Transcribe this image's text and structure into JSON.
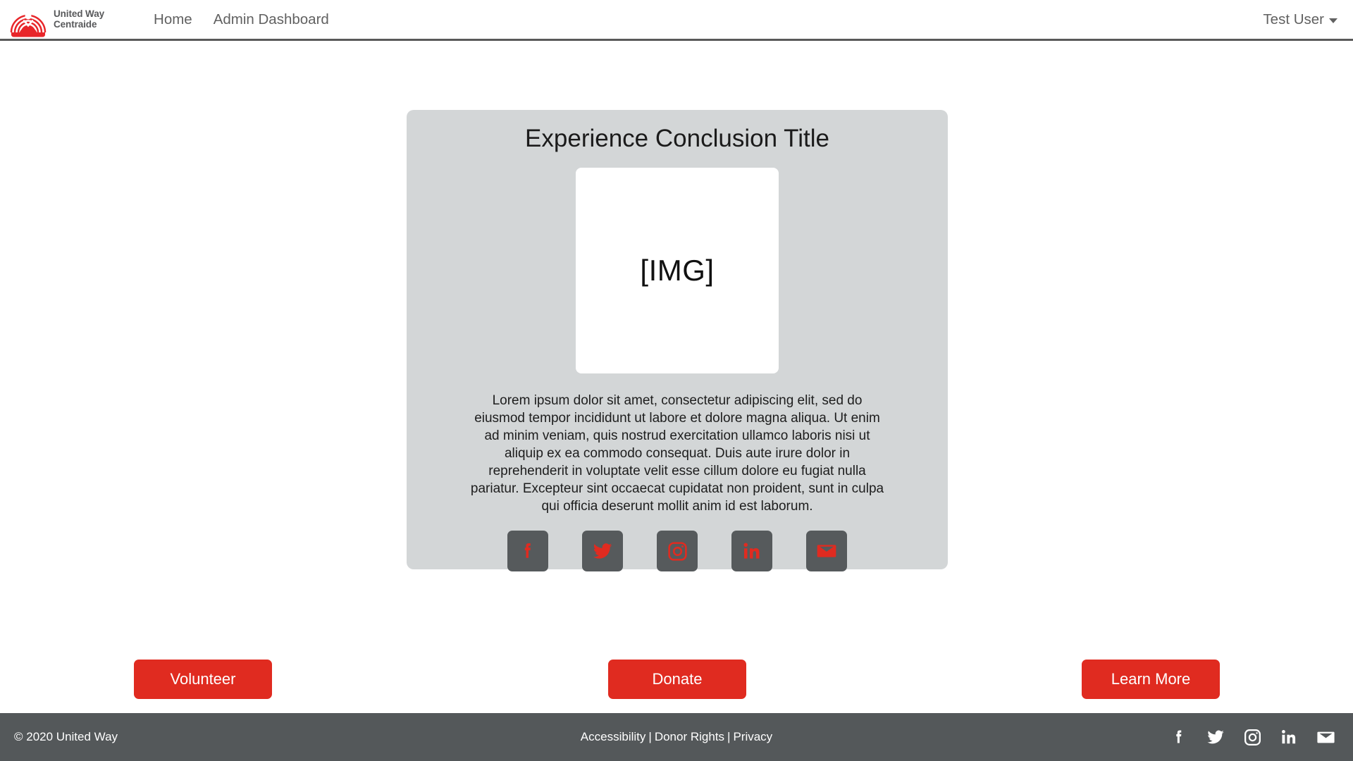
{
  "navbar": {
    "brand": {
      "logo_icon": "united-way-rainbow-hand-logo",
      "wordmark_line1": "United Way",
      "wordmark_line2": "Centraide"
    },
    "links": [
      {
        "label": "Home"
      },
      {
        "label": "Admin Dashboard"
      }
    ],
    "user_menu": {
      "label": "Test User",
      "caret_icon": "chevron-down-icon"
    }
  },
  "card": {
    "title": "Experience Conclusion Title",
    "image_placeholder": "[IMG]",
    "body": "Lorem ipsum dolor sit amet, consectetur adipiscing elit, sed do eiusmod tempor incididunt ut labore et dolore magna aliqua. Ut enim ad minim veniam, quis nostrud exercitation ullamco laboris nisi ut aliquip ex ea commodo consequat. Duis aute irure dolor in reprehenderit in voluptate velit esse cillum dolore eu fugiat nulla pariatur. Excepteur sint occaecat cupidatat non proident, sunt in culpa qui officia deserunt mollit anim id est laborum.",
    "social": [
      {
        "name": "facebook-icon"
      },
      {
        "name": "twitter-icon"
      },
      {
        "name": "instagram-icon"
      },
      {
        "name": "linkedin-icon"
      },
      {
        "name": "email-icon"
      }
    ]
  },
  "cta": {
    "volunteer": "Volunteer",
    "donate": "Donate",
    "learn_more": "Learn More"
  },
  "footer": {
    "copyright": "© 2020 United Way",
    "links": [
      {
        "label": "Accessibility"
      },
      {
        "label": "Donor Rights"
      },
      {
        "label": "Privacy"
      }
    ],
    "separator": "|",
    "social": [
      {
        "name": "facebook-icon"
      },
      {
        "name": "twitter-icon"
      },
      {
        "name": "instagram-icon"
      },
      {
        "name": "linkedin-icon"
      },
      {
        "name": "email-icon"
      }
    ]
  },
  "colors": {
    "brand_red": "#e02b20",
    "card_bg": "#d3d6d7",
    "footer_bg": "#54585a",
    "social_tile_bg": "#565a5c",
    "nav_text": "#616161"
  }
}
